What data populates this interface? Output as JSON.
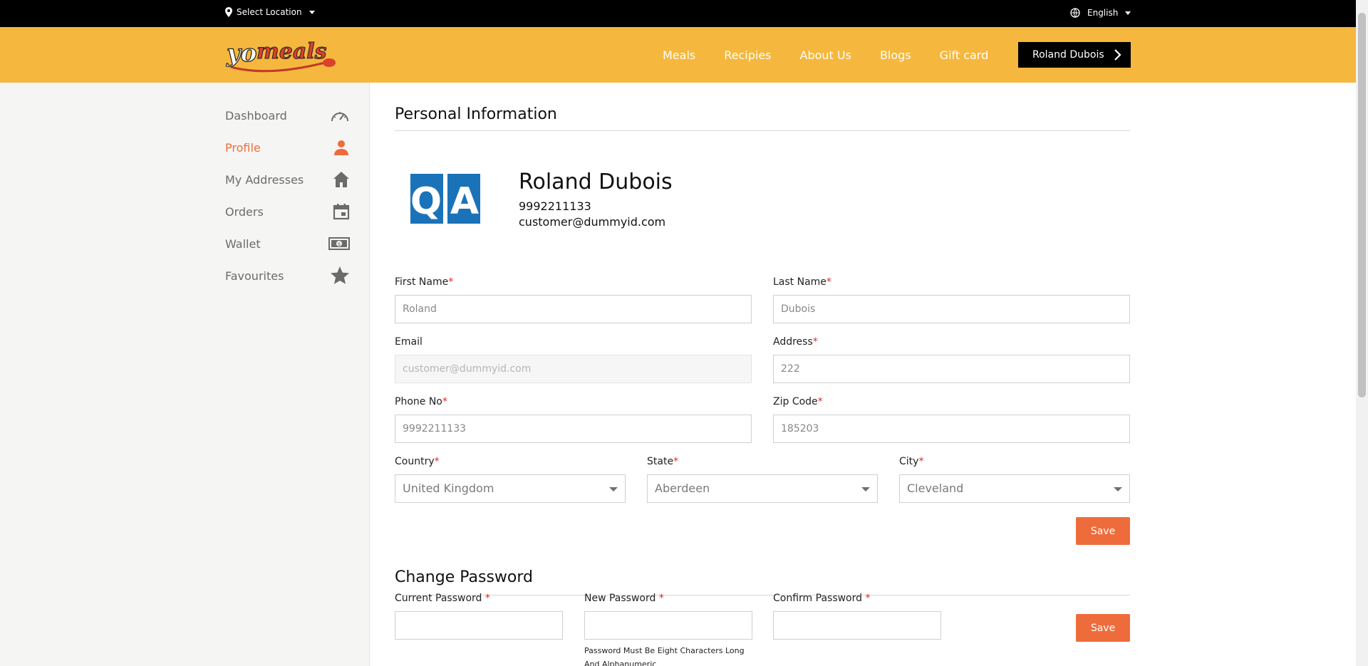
{
  "topbar": {
    "location": "Select Location",
    "language": "English"
  },
  "header": {
    "logo_text": "yomeals",
    "nav": [
      "Meals",
      "Recipies",
      "About Us",
      "Blogs",
      "Gift card"
    ],
    "user_button": "Roland Dubois"
  },
  "sidebar": {
    "items": [
      {
        "label": "Dashboard",
        "icon": "speedometer-icon"
      },
      {
        "label": "Profile",
        "icon": "user-icon"
      },
      {
        "label": "My Addresses",
        "icon": "home-icon"
      },
      {
        "label": "Orders",
        "icon": "calendar-icon"
      },
      {
        "label": "Wallet",
        "icon": "cash-icon"
      },
      {
        "label": "Favourites",
        "icon": "star-icon"
      }
    ]
  },
  "personal": {
    "title": "Personal Information",
    "avatar_text": "QA",
    "name": "Roland Dubois",
    "phone": "9992211133",
    "email": "customer@dummyid.com"
  },
  "form": {
    "first_name": {
      "label": "First Name",
      "value": "Roland"
    },
    "last_name": {
      "label": "Last Name",
      "value": "Dubois"
    },
    "email": {
      "label": "Email",
      "value": "customer@dummyid.com"
    },
    "address": {
      "label": "Address",
      "value": "222"
    },
    "phone": {
      "label": "Phone No",
      "value": "9992211133"
    },
    "zip": {
      "label": "Zip Code",
      "value": "185203"
    },
    "country": {
      "label": "Country",
      "value": "United Kingdom"
    },
    "state": {
      "label": "State",
      "value": "Aberdeen"
    },
    "city": {
      "label": "City",
      "value": "Cleveland"
    },
    "save": "Save"
  },
  "password": {
    "title": "Change Password",
    "current": {
      "label": "Current Password",
      "value": ""
    },
    "new": {
      "label": "New Password",
      "value": ""
    },
    "confirm": {
      "label": "Confirm Password",
      "value": ""
    },
    "hint": "Password Must Be Eight Characters Long And Alphanumeric",
    "save": "Save"
  },
  "colors": {
    "accent": "#ee6c3c",
    "header": "#f5b73d",
    "topbar": "#000000"
  }
}
